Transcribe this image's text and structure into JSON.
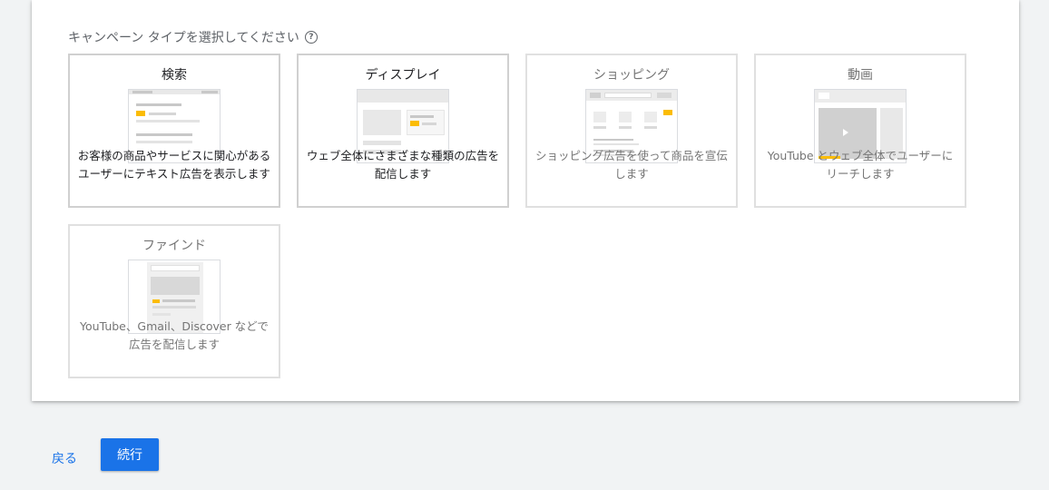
{
  "heading": "キャンペーン タイプを選択してください",
  "help_icon_glyph": "?",
  "cards": [
    {
      "title": "検索",
      "desc": "お客様の商品やサービスに関心があるユーザーにテキスト広告を表示します"
    },
    {
      "title": "ディスプレイ",
      "desc": "ウェブ全体にさまざまな種類の広告を配信します"
    },
    {
      "title": "ショッピング",
      "desc": "ショッピング広告を使って商品を宣伝します"
    },
    {
      "title": "動画",
      "desc": "YouTube とウェブ全体でユーザーにリーチします"
    },
    {
      "title": "ファインド",
      "desc": "YouTube、Gmail、Discover などで広告を配信します"
    }
  ],
  "buttons": {
    "back": "戻る",
    "continue": "続行"
  },
  "colors": {
    "accent": "#1a73e8",
    "highlight": "#fbbc04"
  }
}
